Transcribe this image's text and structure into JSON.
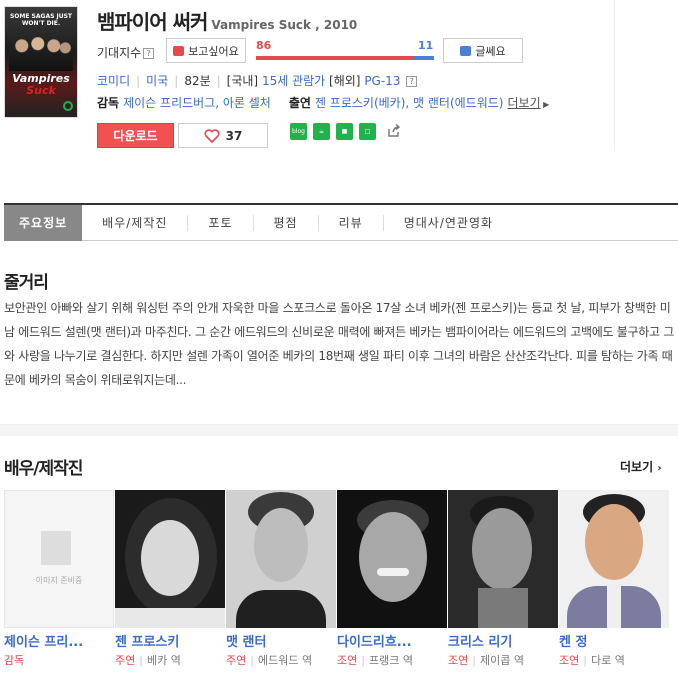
{
  "movie": {
    "title_ko": "뱀파이어 써커",
    "title_en": "Vampires Suck , 2010",
    "poster_tagline": "SOME SAGAS JUST WON'T DIE.",
    "poster_logo_1": "Vampires",
    "poster_logo_2": "Suck"
  },
  "expectation": {
    "label": "기대지수",
    "help": "?",
    "like_label": "보고싶어요",
    "dislike_label": "글쎄요",
    "like_score": "86",
    "dislike_score": "11",
    "like_fraction": 0.886
  },
  "meta": {
    "genre": "코미디",
    "country": "미국",
    "runtime": "82분",
    "rating_domestic_prefix": "[국내]",
    "rating_domestic": "15세 관람가",
    "rating_foreign_prefix": "[해외]",
    "rating_foreign": "PG-13",
    "help": "?"
  },
  "credits": {
    "director_label": "감독",
    "directors": "제이슨 프리드버그, 아론 셀처",
    "cast_label": "출연",
    "cast": "젠 프로스키(베카), 맷 랜터(에드워드)",
    "more": "더보기"
  },
  "actions": {
    "download": "다운로드",
    "likes": "37",
    "social_blog": "blog"
  },
  "tabs": [
    {
      "label": "주요정보"
    },
    {
      "label": "배우/제작진"
    },
    {
      "label": "포토"
    },
    {
      "label": "평점"
    },
    {
      "label": "리뷰"
    },
    {
      "label": "명대사/연관영화"
    }
  ],
  "synopsis": {
    "title": "줄거리",
    "text": "보안관인 아빠와 살기 위해 워싱턴 주의 안개 자욱한 마을 스포크스로 돌아온 17살 소녀 베카(젠 프로스키)는 등교 첫 날, 피부가 창백한 미남 에드워드 설렌(맷 랜터)과 마주친다. 그 순간 에드워드의 신비로운 매력에 빠져든 베카는 뱀파이어라는 에드워드의 고백에도 불구하고 그와 사랑을 나누기로 결심한다. 하지만 설렌 가족이 열어준 베카의 18번째 생일 파티 이후 그녀의 바람은 산산조각난다. 피를 탐하는 가족 때문에 베카의 목숨이 위태로워지는데..."
  },
  "cast_section": {
    "title": "배우/제작진",
    "more": "더보기",
    "no_image": "이미지 준비중",
    "people": [
      {
        "name": "제이슨 프리...",
        "position": "감독",
        "role": ""
      },
      {
        "name": "젠 프로스키",
        "position": "주연",
        "role": "베카 역"
      },
      {
        "name": "맷 랜터",
        "position": "주연",
        "role": "에드워드 역"
      },
      {
        "name": "다이드리흐...",
        "position": "조연",
        "role": "프랭크 역"
      },
      {
        "name": "크리스 리기",
        "position": "조연",
        "role": "제이콥 역"
      },
      {
        "name": "켄 정",
        "position": "조연",
        "role": "다로 역"
      }
    ]
  }
}
